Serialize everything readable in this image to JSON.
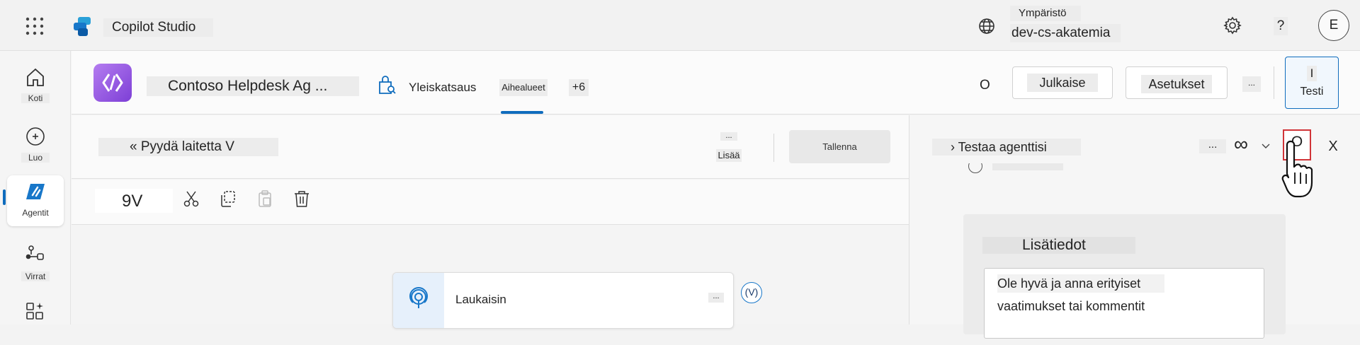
{
  "topbar": {
    "app_title": "Copilot Studio",
    "env_label": "Ympäristö",
    "env_name": "dev-cs-akatemia",
    "help": "?",
    "avatar_initial": "E"
  },
  "rail": {
    "items": [
      {
        "label": "Koti"
      },
      {
        "label": "Luo"
      },
      {
        "label": "Agentit"
      },
      {
        "label": "Virrat"
      }
    ]
  },
  "agent_header": {
    "name": "Contoso Helpdesk Ag ...",
    "tabs": [
      "Yleiskatsaus",
      "Aihealueet",
      "+6"
    ],
    "active_tab": "Aihealueet",
    "o_label": "O",
    "publish": "Julkaise",
    "settings": "Asetukset",
    "more": "...",
    "test_icon": "I",
    "test": "Testi"
  },
  "editor": {
    "topic_title": "« Pyydä laitetta V",
    "more": "...",
    "add": "Lisää",
    "save": "Tallenna",
    "toolbar_label": "9V",
    "trigger_label": "Laukaisin",
    "trigger_more": "...",
    "var_badge": "(V)"
  },
  "test_pane": {
    "title": "› Testaa agenttisi",
    "more": "...",
    "infinity": "∞",
    "refresh_symbol": "O",
    "close": "X",
    "card_title": "Lisätiedot",
    "card_text_1": "Ole hyvä ja anna erityiset",
    "card_text_2": "vaatimukset tai kommentit"
  },
  "colors": {
    "accent": "#0f6cbd",
    "highlight_box": "#d13438",
    "agent_gradient_start": "#b47cf0",
    "agent_gradient_end": "#7d3fd6"
  }
}
